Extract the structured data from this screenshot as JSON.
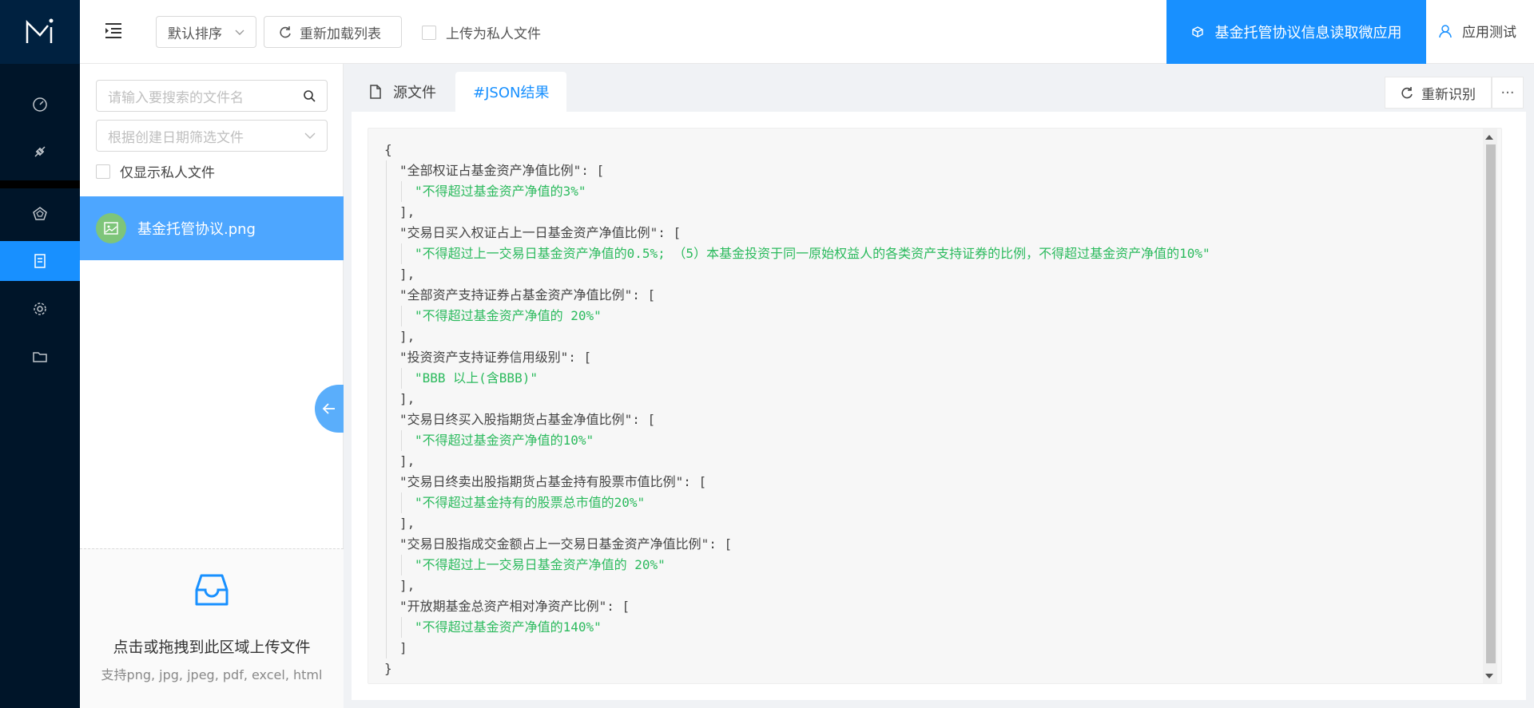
{
  "header": {
    "sort_label": "默认排序",
    "reload_label": "重新加载列表",
    "private_upload_label": "上传为私人文件",
    "app_label": "基金托管协议信息读取微应用",
    "user_label": "应用测试"
  },
  "file_panel": {
    "search_placeholder": "请输入要搜索的文件名",
    "date_placeholder": "根据创建日期筛选文件",
    "only_private_label": "仅显示私人文件",
    "files": [
      {
        "name": "基金托管协议.png"
      }
    ],
    "upload_title": "点击或拖拽到此区域上传文件",
    "upload_hint": "支持png, jpg, jpeg, pdf, excel, html"
  },
  "tabs": [
    {
      "label": "源文件"
    },
    {
      "label": "#JSON结果"
    }
  ],
  "actions": {
    "rerecognize_label": "重新识别",
    "more_label": "···"
  },
  "json_lines": [
    {
      "text": "{",
      "type": "k",
      "indent": 0
    },
    {
      "text": "\"全部权证占基金资产净值比例\": [",
      "type": "k",
      "indent": 1
    },
    {
      "text": "\"不得超过基金资产净值的3%\"",
      "type": "s",
      "indent": 2
    },
    {
      "text": "],",
      "type": "k",
      "indent": 1
    },
    {
      "text": "\"交易日买入权证占上一日基金资产净值比例\": [",
      "type": "k",
      "indent": 1
    },
    {
      "text": "\"不得超过上一交易日基金资产净值的0.5%; （5）本基金投资于同一原始权益人的各类资产支持证券的比例，不得超过基金资产净值的10%\"",
      "type": "s",
      "indent": 2
    },
    {
      "text": "],",
      "type": "k",
      "indent": 1
    },
    {
      "text": "\"全部资产支持证券占基金资产净值比例\": [",
      "type": "k",
      "indent": 1
    },
    {
      "text": "\"不得超过基金资产净值的 20%\"",
      "type": "s",
      "indent": 2
    },
    {
      "text": "],",
      "type": "k",
      "indent": 1
    },
    {
      "text": "\"投资资产支持证券信用级别\": [",
      "type": "k",
      "indent": 1
    },
    {
      "text": "\"BBB 以上(含BBB)\"",
      "type": "s",
      "indent": 2
    },
    {
      "text": "],",
      "type": "k",
      "indent": 1
    },
    {
      "text": "\"交易日终买入股指期货占基金净值比例\": [",
      "type": "k",
      "indent": 1
    },
    {
      "text": "\"不得超过基金资产净值的10%\"",
      "type": "s",
      "indent": 2
    },
    {
      "text": "],",
      "type": "k",
      "indent": 1
    },
    {
      "text": "\"交易日终卖出股指期货占基金持有股票市值比例\": [",
      "type": "k",
      "indent": 1
    },
    {
      "text": "\"不得超过基金持有的股票总市值的20%\"",
      "type": "s",
      "indent": 2
    },
    {
      "text": "],",
      "type": "k",
      "indent": 1
    },
    {
      "text": "\"交易日股指成交金额占上一交易日基金资产净值比例\": [",
      "type": "k",
      "indent": 1
    },
    {
      "text": "\"不得超过上一交易日基金资产净值的 20%\"",
      "type": "s",
      "indent": 2
    },
    {
      "text": "],",
      "type": "k",
      "indent": 1
    },
    {
      "text": "\"开放期基金总资产相对净资产比例\": [",
      "type": "k",
      "indent": 1
    },
    {
      "text": "\"不得超过基金资产净值的140%\"",
      "type": "s",
      "indent": 2
    },
    {
      "text": "]",
      "type": "k",
      "indent": 1
    },
    {
      "text": "}",
      "type": "k",
      "indent": 0
    }
  ],
  "colors": {
    "primary": "#1890ff",
    "sidebar": "#001529",
    "json_string": "#2bba5d"
  }
}
